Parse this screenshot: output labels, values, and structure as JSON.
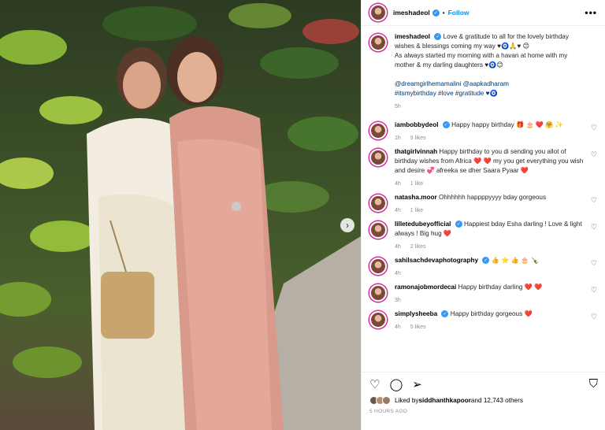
{
  "post": {
    "username": "imeshadeol",
    "follow_label": "Follow",
    "more_label": "•••",
    "next_label": "›"
  },
  "caption": {
    "username": "imeshadeol",
    "text": "Love & gratitude to all for the lovely birthday wishes & blessings coming my way ♥🧿🙏♥ 😊",
    "text2": "As always started my morning with a havan at home with my mother & my darling daughters ♥🧿😊",
    "mentions": "@dreamgirlhemamalini @aapkadharam",
    "hashtags": "#itsmybirthday #love #gratitude ♥🧿",
    "time": "5h"
  },
  "comments": [
    {
      "username": "iambobbydeol",
      "text": "Happy happy birthday 🎁 🎂 ❤️ 🤗 ✨",
      "time": "1h",
      "likes": "9 likes"
    },
    {
      "username": "thatgirlvinnah",
      "text": "Happy birthday to you di sending you allot of birthday wishes from Africa ❤️ ❤️ my you get everything you wish and desire 💞 afreeka se dher Saara Pyaar ❤️",
      "time": "4h",
      "likes": "1 like"
    },
    {
      "username": "natasha.moor",
      "text": "Ohhhhhh happppyyyy bday gorgeous",
      "time": "4h",
      "likes": "1 like"
    },
    {
      "username": "lilletedubeyofficial",
      "text": "Happiest bday Esha darling ! Love & light always ! Big hug ❤️",
      "time": "4h",
      "likes": "2 likes"
    },
    {
      "username": "sahilsachdevaphotography",
      "text": "👍 ⭐ 👍 🎂 🍾",
      "time": "4h",
      "likes": ""
    },
    {
      "username": "ramonajobmordecai",
      "text": "Happy birthday darling ❤️ ❤️",
      "time": "3h",
      "likes": ""
    },
    {
      "username": "simplysheeba",
      "text": "Happy birthday gorgeous ❤️",
      "time": "4h",
      "likes": "5 likes"
    }
  ],
  "icons": {
    "heart": "♡",
    "comment": "◯",
    "share": "➢",
    "save": "⛉"
  },
  "likes": {
    "prefix": "Liked by ",
    "user": "siddhanthkapoor",
    "suffix": " and 12,743 others"
  },
  "timestamp": "5 HOURS AGO",
  "colors": {
    "follow": "#0095f6",
    "verified": "#3897f0",
    "link": "#00376b"
  }
}
